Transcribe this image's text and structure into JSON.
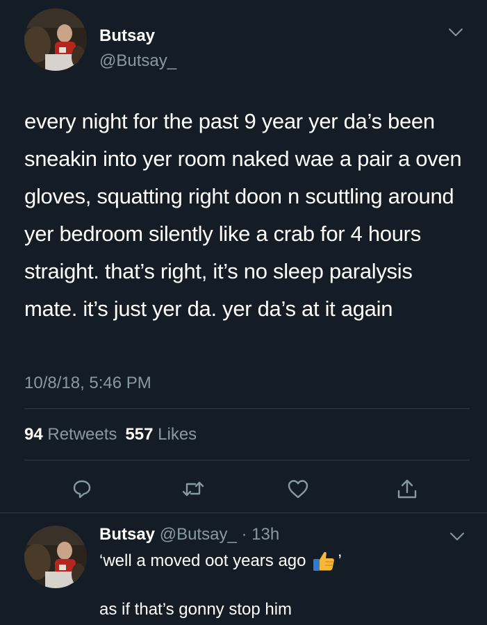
{
  "tweet": {
    "author_name": "Butsay",
    "author_handle": "@Butsay_",
    "text": "every night for the past 9 year yer da’s been sneakin into yer room naked wae a pair a oven gloves, squatting right doon n scuttling around yer bedroom silently like a crab for 4 hours straight. that’s right, it’s no sleep paralysis mate. it’s just yer da. yer da’s at it again",
    "timestamp": "10/8/18, 5:46 PM",
    "retweets_count": "94",
    "retweets_label": "Retweets",
    "likes_count": "557",
    "likes_label": "Likes"
  },
  "actions": [
    {
      "icon": "reply-icon"
    },
    {
      "icon": "retweet-icon"
    },
    {
      "icon": "like-icon"
    },
    {
      "icon": "share-icon"
    }
  ],
  "reply": {
    "author_name": "Butsay",
    "author_handle": "@Butsay_",
    "separator": " · ",
    "time": "13h",
    "line1_before": "‘well a moved oot years ago",
    "emoji": "thumbs-up-emoji",
    "line1_after": "’",
    "line2": "as if that’s gonny stop him"
  },
  "colors": {
    "background": "#141d26",
    "text_primary": "#ffffff",
    "text_secondary": "#8899a6",
    "divider": "#2f3d4a"
  }
}
